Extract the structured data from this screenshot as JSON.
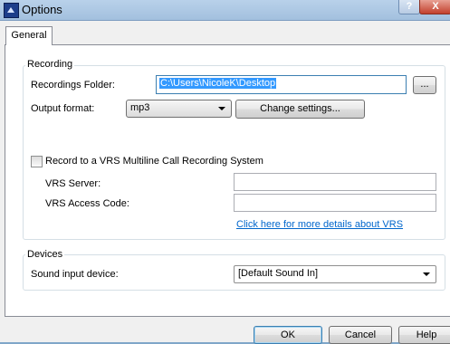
{
  "window": {
    "title": "Options",
    "help_button": "?",
    "close_button": "X"
  },
  "tabs": [
    {
      "label": "General",
      "active": true
    }
  ],
  "recording": {
    "group_title": "Recording",
    "folder_label": "Recordings Folder:",
    "folder_value": "C:\\Users\\NicoleK\\Desktop",
    "browse_button": "...",
    "format_label": "Output format:",
    "format_value": "mp3",
    "change_settings_button": "Change settings...",
    "vrs_checkbox_label": "Record to a VRS Multiline Call Recording System",
    "vrs_checkbox_checked": false,
    "vrs_server_label": "VRS Server:",
    "vrs_server_value": "",
    "vrs_access_label": "VRS Access Code:",
    "vrs_access_value": "",
    "vrs_link": "Click here for more details about VRS"
  },
  "devices": {
    "group_title": "Devices",
    "sound_input_label": "Sound input device:",
    "sound_input_value": "[Default Sound In]"
  },
  "buttons": {
    "ok": "OK",
    "cancel": "Cancel",
    "help": "Help"
  },
  "colors": {
    "selection": "#3399ff",
    "link": "#0066cc",
    "titlebar": "#a3c0de"
  }
}
